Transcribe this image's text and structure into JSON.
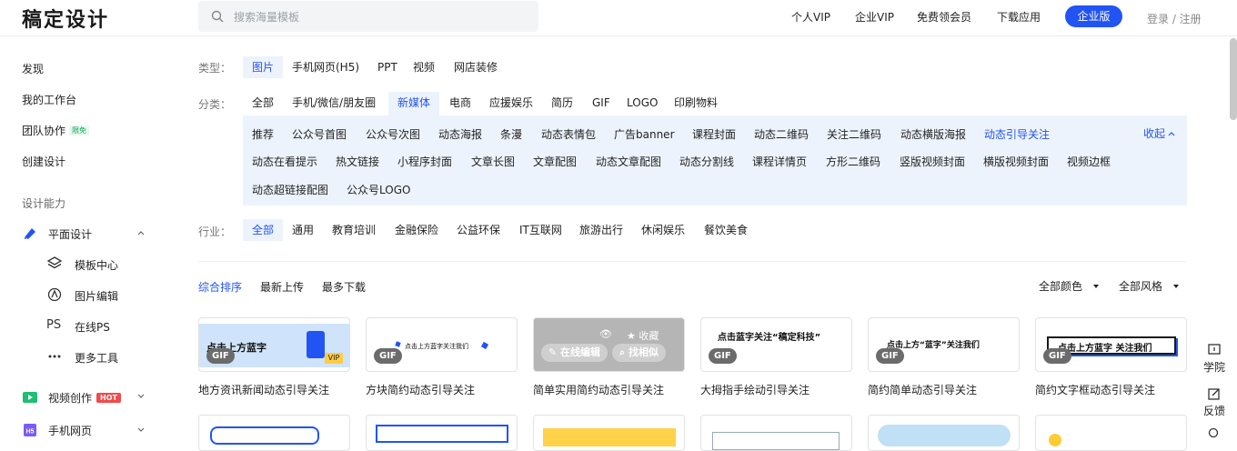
{
  "header": {
    "logo": "稿定设计",
    "search_placeholder": "搜索海量模板",
    "nav": [
      "个人VIP",
      "企业VIP",
      "免费领会员",
      "下载应用"
    ],
    "enterprise": "企业版",
    "login": "登录 / 注册"
  },
  "sidebar": {
    "items": [
      "发现",
      "我的工作台",
      "团队协作",
      "创建设计"
    ],
    "team_badge": "限免",
    "section": "设计能力",
    "flat_design": "平面设计",
    "sub_items": [
      "模板中心",
      "图片编辑",
      "在线PS",
      "更多工具"
    ],
    "video": "视频创作",
    "hot": "HOT",
    "h5": "手机网页"
  },
  "filters": {
    "type_label": "类型：",
    "types": [
      "图片",
      "手机网页(H5)",
      "PPT",
      "视频",
      "网店装修"
    ],
    "cat_label": "分类：",
    "cats": [
      "全部",
      "手机/微信/朋友圈",
      "新媒体",
      "电商",
      "应援娱乐",
      "简历",
      "GIF",
      "LOGO",
      "印刷物料"
    ],
    "subcats_row1": [
      "推荐",
      "公众号首图",
      "公众号次图",
      "动态海报",
      "条漫",
      "动态表情包",
      "广告banner",
      "课程封面",
      "动态二维码",
      "关注二维码",
      "动态横版海报",
      "动态引导关注"
    ],
    "subcats_row2": [
      "动态在看提示",
      "热文链接",
      "小程序封面",
      "文章长图",
      "文章配图",
      "动态文章配图",
      "动态分割线",
      "课程详情页",
      "方形二维码",
      "竖版视频封面",
      "横版视频封面",
      "视频边框"
    ],
    "subcats_row3": [
      "动态超链接配图",
      "公众号LOGO"
    ],
    "collapse": "收起",
    "industry_label": "行业：",
    "industries": [
      "全部",
      "通用",
      "教育培训",
      "金融保险",
      "公益环保",
      "IT互联网",
      "旅游出行",
      "休闲娱乐",
      "餐饮美食"
    ]
  },
  "sort": {
    "options": [
      "综合排序",
      "最新上传",
      "最多下载"
    ],
    "color": "全部颜色",
    "style": "全部风格"
  },
  "cards": [
    {
      "title": "地方资讯新闻动态引导关注",
      "badge": "GIF",
      "text": "点击上方蓝字"
    },
    {
      "title": "方块简约动态引导关注",
      "badge": "GIF",
      "text": "点击上方蓝字关注我们"
    },
    {
      "title": "简单实用简约动态引导关注",
      "badge": "",
      "text": ""
    },
    {
      "title": "大拇指手绘动引导关注",
      "badge": "GIF",
      "text": "点击蓝字关注“稿定科技”"
    },
    {
      "title": "简约简单动态引导关注",
      "badge": "GIF",
      "text": "点击上方“蓝字”关注我们"
    },
    {
      "title": "简约文字框动态引导关注",
      "badge": "GIF",
      "text": "点击上方蓝字 关注我们"
    }
  ],
  "hover": {
    "fav": "收藏",
    "edit": "在线编辑",
    "similar": "找相似"
  },
  "tools": {
    "academy": "学院",
    "feedback": "反馈"
  }
}
